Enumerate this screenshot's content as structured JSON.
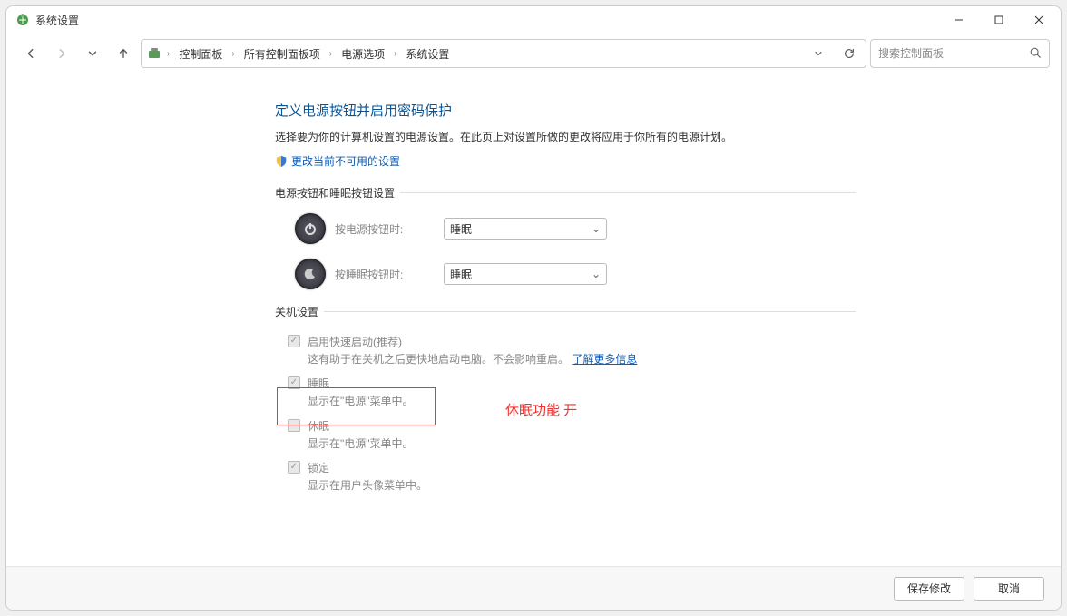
{
  "window": {
    "title": "系统设置"
  },
  "toolbar": {
    "breadcrumbs": [
      "控制面板",
      "所有控制面板项",
      "电源选项",
      "系统设置"
    ],
    "search_placeholder": "搜索控制面板"
  },
  "main": {
    "heading": "定义电源按钮并启用密码保护",
    "subtext": "选择要为你的计算机设置的电源设置。在此页上对设置所做的更改将应用于你所有的电源计划。",
    "shield_link": "更改当前不可用的设置",
    "group1_label": "电源按钮和睡眠按钮设置",
    "power_button_label": "按电源按钮时:",
    "power_button_value": "睡眠",
    "sleep_button_label": "按睡眠按钮时:",
    "sleep_button_value": "睡眠",
    "group2_label": "关机设置",
    "options": {
      "fast_start": {
        "title": "启用快速启动(推荐)",
        "desc_pre": "这有助于在关机之后更快地启动电脑。不会影响重启。",
        "link": "了解更多信息"
      },
      "sleep": {
        "title": "睡眠",
        "desc": "显示在\"电源\"菜单中。"
      },
      "hibernate": {
        "title": "休眠",
        "desc": "显示在\"电源\"菜单中。"
      },
      "lock": {
        "title": "锁定",
        "desc": "显示在用户头像菜单中。"
      }
    }
  },
  "annotation": "休眠功能  开",
  "buttons": {
    "save": "保存修改",
    "cancel": "取消"
  }
}
